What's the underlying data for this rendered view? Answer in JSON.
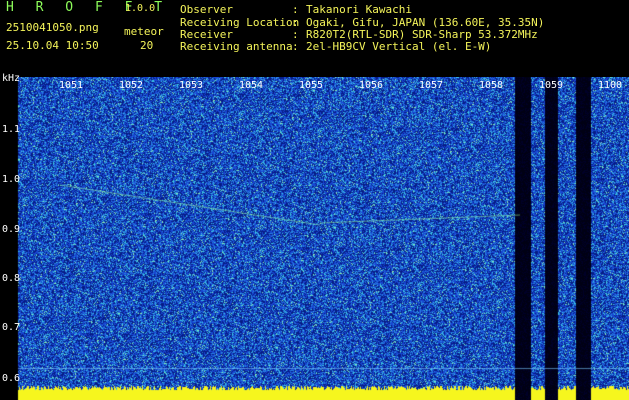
{
  "header": {
    "title": "H R O F F T",
    "version": "1.0.0",
    "filename": "2510041050.png",
    "datetime": "25.10.04 10:50",
    "meteor_label": "meteor",
    "meteor_count": "20"
  },
  "info": [
    {
      "label": "Observer",
      "value": "Takanori Kawachi"
    },
    {
      "label": "Receiving Location",
      "value": "Ogaki, Gifu, JAPAN (136.60E, 35.35N)"
    },
    {
      "label": "Receiver",
      "value": "R820T2(RTL-SDR) SDR-Sharp 53.372MHz"
    },
    {
      "label": "Receiving antenna",
      "value": "2el-HB9CV Vertical (el. E-W)"
    }
  ],
  "separator": ":",
  "axis": {
    "unit": "kHz",
    "y_ticks": [
      "1.1",
      "1.0",
      "0.9",
      "0.8",
      "0.7",
      "0.6"
    ],
    "time_ticks": [
      "1051",
      "1052",
      "1053",
      "1054",
      "1055",
      "1056",
      "1057",
      "1058",
      "1059",
      "1100"
    ]
  },
  "colors": {
    "background": "#000000",
    "noise_dark": "#061c86",
    "noise_mid": "#1f4ad8",
    "noise_light": "#3fc8e6",
    "baseline": "#ffff00",
    "header_green": "#8dfc5a",
    "header_yellow": "#f4f45a"
  }
}
